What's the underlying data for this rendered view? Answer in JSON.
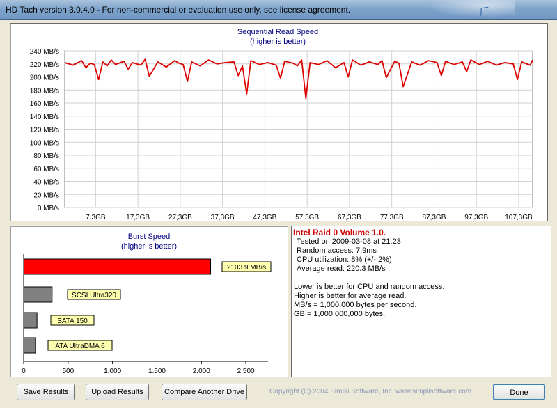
{
  "window": {
    "title": "HD Tach version 3.0.4.0  - For non-commercial or evaluation use only, see license agreement."
  },
  "read_chart": {
    "title": "Sequential Read Speed",
    "subtitle": "(higher is better)"
  },
  "burst_chart": {
    "title": "Burst Speed",
    "subtitle": "(higher is better)"
  },
  "chart_data": [
    {
      "type": "line",
      "title": "Sequential Read Speed",
      "subtitle": "(higher is better)",
      "y_ticks": [
        "240 MB/s",
        "220 MB/s",
        "200 MB/s",
        "180 MB/s",
        "160 MB/s",
        "140 MB/s",
        "120 MB/s",
        "100 MB/s",
        "80 MB/s",
        "60 MB/s",
        "40 MB/s",
        "20 MB/s",
        "0 MB/s"
      ],
      "x_ticks": [
        "7,3GB",
        "17,3GB",
        "27,3GB",
        "37,3GB",
        "47,3GB",
        "57,3GB",
        "67,3GB",
        "77,3GB",
        "87,3GB",
        "97,3GB",
        "107,3GB"
      ],
      "xlim": [
        0,
        110.6
      ],
      "ylim": [
        0,
        240
      ],
      "grid": true,
      "series_color": "#dd0000",
      "x": [
        0,
        2,
        4,
        5,
        6,
        7,
        8,
        9,
        10,
        11,
        12,
        14,
        15,
        16,
        18,
        19,
        20,
        22,
        24,
        26,
        27,
        28,
        29,
        30,
        32,
        34,
        36,
        38,
        40,
        41,
        42,
        43,
        44,
        46,
        48,
        50,
        51,
        52,
        54,
        55,
        56,
        57,
        58,
        60,
        62,
        64,
        66,
        67,
        68,
        70,
        72,
        74,
        75,
        76,
        78,
        79,
        80,
        82,
        84,
        86,
        88,
        89,
        90,
        92,
        94,
        95,
        96,
        98,
        100,
        102,
        104,
        106,
        107,
        108,
        110,
        110.6
      ],
      "values": [
        222,
        218,
        225,
        214,
        221,
        219,
        196,
        223,
        217,
        226,
        219,
        224,
        212,
        222,
        218,
        227,
        201,
        223,
        215,
        225,
        221,
        219,
        193,
        223,
        217,
        226,
        220,
        222,
        223,
        202,
        217,
        174,
        225,
        219,
        222,
        218,
        198,
        224,
        221,
        217,
        226,
        167,
        222,
        219,
        225,
        214,
        222,
        200,
        226,
        218,
        223,
        219,
        225,
        199,
        224,
        221,
        185,
        223,
        218,
        225,
        222,
        202,
        224,
        219,
        223,
        208,
        226,
        219,
        224,
        218,
        222,
        220,
        196,
        223,
        218,
        226
      ]
    },
    {
      "type": "bar",
      "title": "Burst Speed",
      "subtitle": "(higher is better)",
      "categories": [
        "2103.9 MB/s",
        "SCSI Ultra320",
        "SATA 150",
        "ATA UltraDMA 6"
      ],
      "values": [
        2103.9,
        320,
        150,
        133
      ],
      "colors": [
        "#ff0000",
        "#808080",
        "#808080",
        "#808080"
      ],
      "x_ticks": [
        "0",
        "500",
        "1.000",
        "1.500",
        "2.000",
        "2.500"
      ],
      "xlim": [
        0,
        2750
      ]
    }
  ],
  "info": {
    "drive": "Intel Raid 0 Volume 1.0.",
    "tested": "Tested on 2009-03-08 at 21:23",
    "random_access": "Random access: 7.9ms",
    "cpu": "CPU utilization: 8% (+/- 2%)",
    "average": "Average read: 220.3 MB/s",
    "note1": "Lower is better for CPU and random access.",
    "note2": "Higher is better for average read.",
    "note3": "MB/s = 1,000,000 bytes per second.",
    "note4": "GB = 1,000,000,000 bytes."
  },
  "buttons": {
    "save": "Save Results",
    "upload": "Upload Results",
    "compare": "Compare Another Drive",
    "done": "Done"
  },
  "copyright": "Copyright (C) 2004 Simpli Software, Inc. www.simplisoftware.com"
}
